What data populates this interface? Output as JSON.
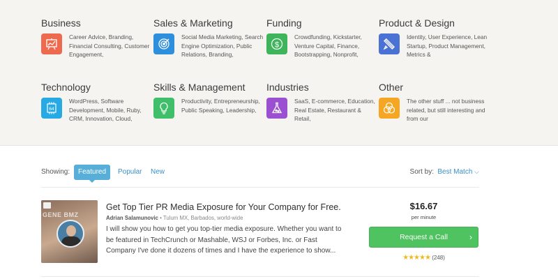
{
  "categories": [
    {
      "title": "Business",
      "desc": "Career Advice, Branding, Financial Consulting, Customer Engagement,",
      "icon": "presentation-chart-icon",
      "color": "#ee6a4e"
    },
    {
      "title": "Sales & Marketing",
      "desc": "Social Media Marketing, Search Engine Optimization, Public Relations, Branding,",
      "icon": "target-icon",
      "color": "#2e8fdc"
    },
    {
      "title": "Funding",
      "desc": "Crowdfunding, Kickstarter, Venture Capital, Finance, Bootstrapping, Nonprofit,",
      "icon": "dollar-icon",
      "color": "#3eb55b"
    },
    {
      "title": "Product & Design",
      "desc": "Identity, User Experience, Lean Startup, Product Management, Metrics &",
      "icon": "pencil-ruler-icon",
      "color": "#4a72d4"
    },
    {
      "title": "Technology",
      "desc": "WordPress, Software Development, Mobile, Ruby, CRM, Innovation, Cloud,",
      "icon": "chip-icon",
      "color": "#27a9e3"
    },
    {
      "title": "Skills & Management",
      "desc": "Productivity, Entrepreneurship, Public Speaking, Leadership,",
      "icon": "lightbulb-icon",
      "color": "#3fbf69"
    },
    {
      "title": "Industries",
      "desc": "SaaS, E-commerce, Education, Real Estate, Restaurant & Retail,",
      "icon": "flask-icon",
      "color": "#9b4fd1"
    },
    {
      "title": "Other",
      "desc": "The other stuff ... not business related, but still interesting and from our",
      "icon": "circles-icon",
      "color": "#f5a623"
    }
  ],
  "controls": {
    "showing_label": "Showing:",
    "tabs": [
      "Featured",
      "Popular",
      "New"
    ],
    "sort_label": "Sort by:",
    "sort_value": "Best Match"
  },
  "listing": {
    "thumb_text": "GENE BMZ",
    "title": "Get Top Tier PR Media Exposure for Your Company for Free.",
    "author": "Adrian Salamunovic",
    "location": "Tulum MX, Barbados, world-wide",
    "description": "I will show you how to get you top-tier media exposure. Whether you want to be featured in TechCrunch or Mashable, WSJ or Forbes, Inc. or Fast Company I've done it dozens of times and I have the experience to show...",
    "price": "$16.67",
    "per_minute": "per minute",
    "cta_label": "Request a Call",
    "stars": "★★★★★",
    "rating_count": "(248)"
  }
}
